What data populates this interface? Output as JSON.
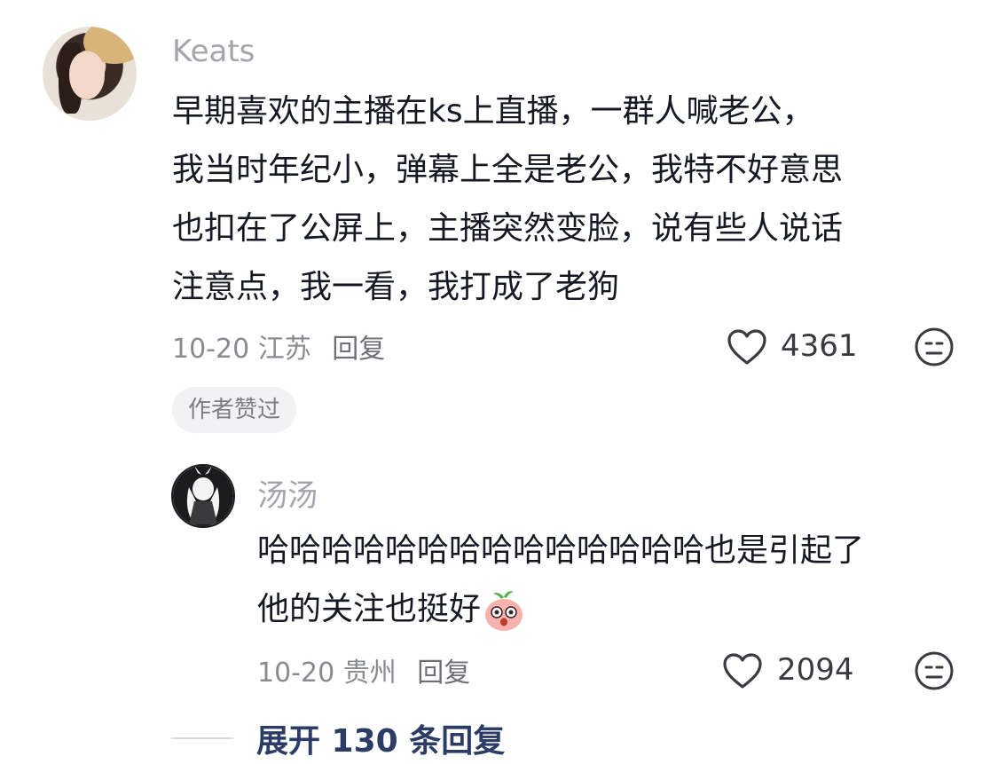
{
  "comment": {
    "username": "Keats",
    "text_lines": [
      "早期喜欢的主播在ks上直播，一群人喊老公，",
      "我当时年纪小，弹幕上全是老公，我特不好意思",
      "也扣在了公屏上，主播突然变脸，说有些人说话",
      "注意点，我一看，我打成了老狗"
    ],
    "date": "10-20",
    "location": "江苏",
    "reply_label": "回复",
    "like_count": "4361",
    "author_badge": "作者赞过"
  },
  "reply": {
    "username": "汤汤",
    "text_lines": [
      "哈哈哈哈哈哈哈哈哈哈哈哈哈哈也是引起了",
      "他的关注也挺好"
    ],
    "emoji": "laughing-peach-emoji",
    "date": "10-20",
    "location": "贵州",
    "reply_label": "回复",
    "like_count": "2094"
  },
  "expand": {
    "label": "展开 130 条回复"
  },
  "icons": {
    "like": "heart-outline-icon",
    "dislike": "meh-face-icon"
  }
}
